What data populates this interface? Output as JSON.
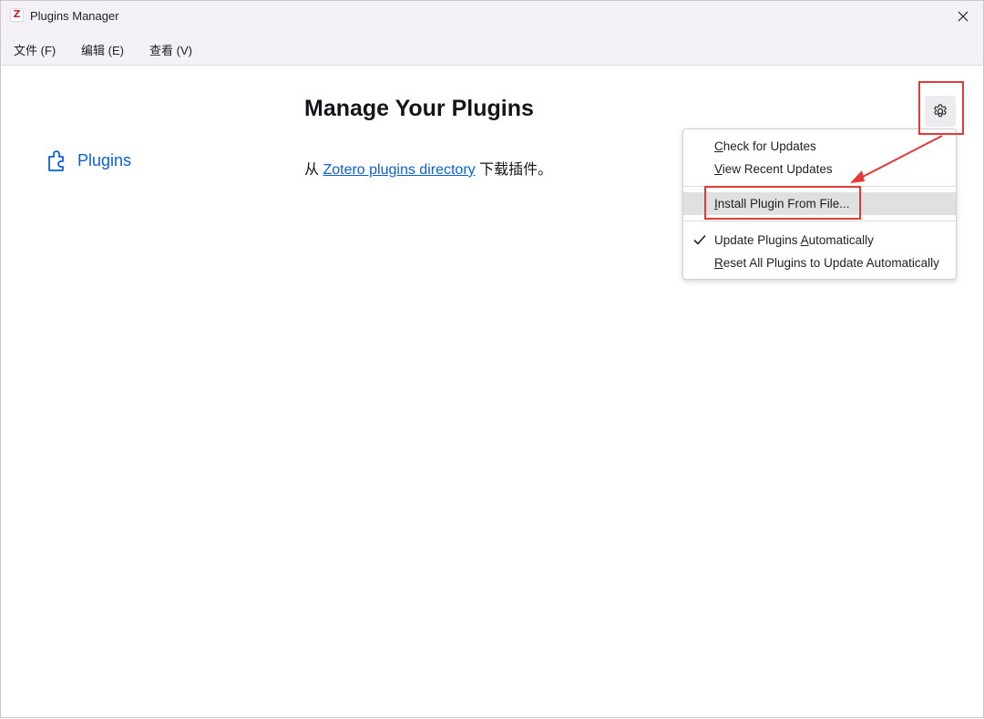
{
  "window": {
    "title": "Plugins Manager",
    "app_icon_letter": "Z"
  },
  "menubar": {
    "items": [
      "文件 (F)",
      "编辑 (E)",
      "查看 (V)"
    ]
  },
  "sidebar": {
    "plugins_label": "Plugins"
  },
  "main": {
    "heading": "Manage Your Plugins",
    "desc_prefix": "从 ",
    "desc_link": "Zotero plugins directory",
    "desc_suffix": " 下载插件。"
  },
  "dropdown": {
    "check_updates": {
      "hot": "C",
      "rest": "heck for Updates"
    },
    "view_recent": {
      "hot": "V",
      "rest": "iew Recent Updates"
    },
    "install_from_file": {
      "hot": "I",
      "rest": "nstall Plugin From File..."
    },
    "update_auto": {
      "pre": "Update Plugins ",
      "hot": "A",
      "rest": "utomatically",
      "checked": true
    },
    "reset_all": {
      "hot": "R",
      "rest": "eset All Plugins to Update Automatically"
    }
  },
  "colors": {
    "link": "#0a61d8",
    "annotation": "#e53935",
    "titlebar": "#f3f0f7"
  },
  "icons": [
    "zotero-app-icon",
    "close-icon",
    "puzzle-piece-icon",
    "gear-icon",
    "checkmark-icon"
  ]
}
